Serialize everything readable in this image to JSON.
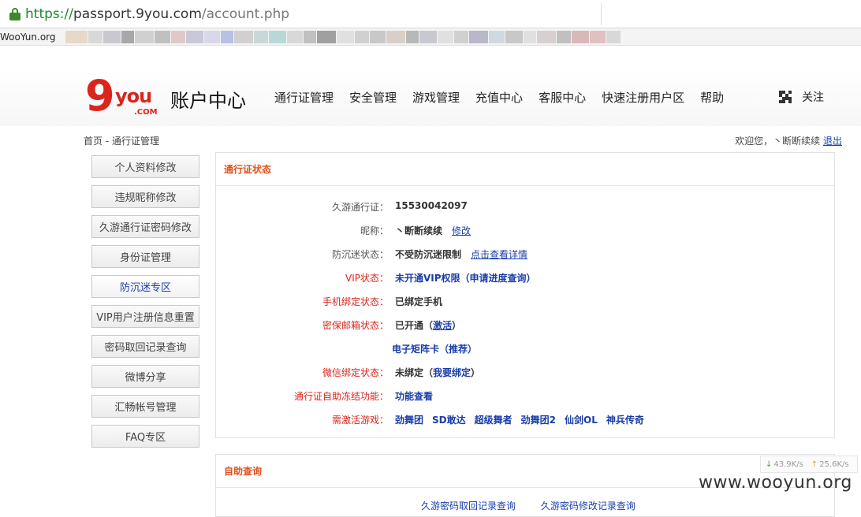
{
  "browser": {
    "url_scheme": "https://",
    "url_host": "passport.9you.com",
    "url_path": "/account.php",
    "first_bookmark": "WooYun.org",
    "blurred_colors": [
      "#e8d8c8",
      "#d8d8d8",
      "#c8c8d0",
      "#a8a8a8",
      "#d0d0d0",
      "#c0c0c0",
      "#e0c8c8",
      "#c8c8d8",
      "#d8d8e8",
      "#b8c0e8",
      "#d0d0d0",
      "#c8d8d8",
      "#b8d8d8",
      "#d8d8d8",
      "#c0c0c0",
      "#a0a0a0",
      "#e0e0e0",
      "#d0d0d0",
      "#c8c8c8",
      "#d8d0c8",
      "#b8b8b8",
      "#c8c8d0",
      "#e0e0e0",
      "#d0d0d0",
      "#b8b8c8",
      "#d0d8e0",
      "#c8c8c8",
      "#e0e0e0",
      "#d8d0d0",
      "#c0c0c0",
      "#d8b8b8",
      "#e0c0c0",
      "#d8d8d8"
    ]
  },
  "site": {
    "logo_num": "9",
    "logo_word": "you",
    "logo_com": ".COM",
    "title": "账户中心",
    "nav": [
      "通行证管理",
      "安全管理",
      "游戏管理",
      "充值中心",
      "客服中心",
      "快速注册用户区",
      "帮助"
    ],
    "follow": "关注"
  },
  "breadcrumb": "首页 - 通行证管理",
  "welcome": {
    "text": "欢迎您，丶断断续续",
    "logout": "退出"
  },
  "sidebar": [
    {
      "label": "个人资料修改",
      "active": false
    },
    {
      "label": "违规昵称修改",
      "active": false
    },
    {
      "label": "久游通行证密码修改",
      "active": false
    },
    {
      "label": "身份证管理",
      "active": false
    },
    {
      "label": "防沉迷专区",
      "active": true
    },
    {
      "label": "VIP用户注册信息重置",
      "active": false
    },
    {
      "label": "密码取回记录查询",
      "active": false
    },
    {
      "label": "微博分享",
      "active": false
    },
    {
      "label": "汇畅帐号管理",
      "active": false
    },
    {
      "label": "FAQ专区",
      "active": false
    }
  ],
  "status_panel": {
    "title": "通行证状态",
    "passport_label": "久游通行证：",
    "passport_value": "15530042097",
    "nickname_label": "昵称：",
    "nickname_value": "丶断断续续",
    "nickname_edit": "修改",
    "antiaddict_label": "防沉迷状态：",
    "antiaddict_value": "不受防沉迷限制",
    "antiaddict_link": "点击查看详情",
    "vip_label": "VIP状态：",
    "vip_value": "未开通VIP权限（申请进度查询）",
    "phone_label": "手机绑定状态：",
    "phone_value": "已绑定手机",
    "email_label": "密保邮箱状态：",
    "email_prefix": "已开通（",
    "email_link": "激活",
    "email_suffix": "）",
    "matrix_value": "电子矩阵卡（推荐）",
    "wechat_label": "微信绑定状态：",
    "wechat_prefix": "未绑定（",
    "wechat_link": "我要绑定",
    "wechat_suffix": "）",
    "freeze_label": "通行证自助冻结功能：",
    "freeze_value": "功能查看",
    "games_label": "需激活游戏：",
    "games": [
      "劲舞团",
      "SD敢达",
      "超级舞者",
      "劲舞团2",
      "仙剑OL",
      "神兵传奇"
    ]
  },
  "self_query_panel": {
    "title": "自助查询",
    "links": [
      "久游密码取回记录查询",
      "久游密码修改记录查询"
    ]
  },
  "speed": {
    "down": "43.9K/s",
    "up": "25.6K/s"
  },
  "watermark": "www.wooyun.org"
}
